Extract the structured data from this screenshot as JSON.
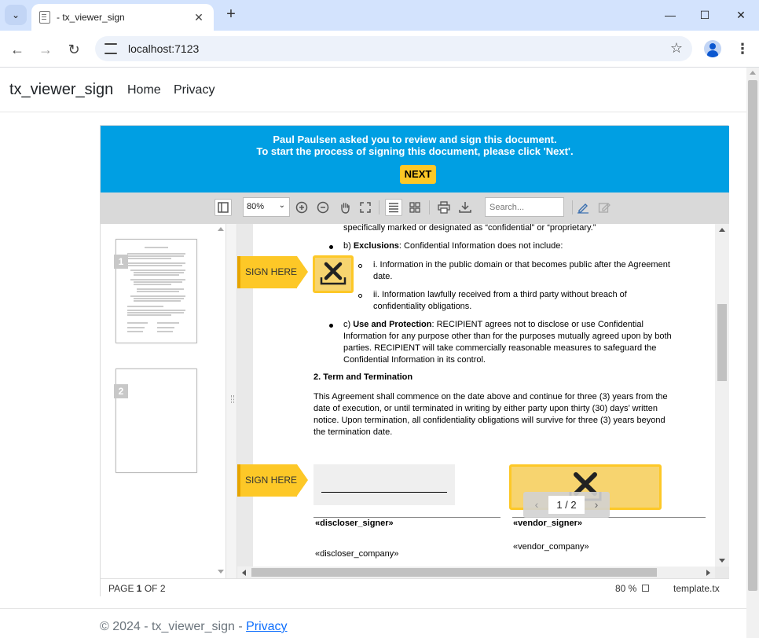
{
  "browser": {
    "tab_title": "- tx_viewer_sign",
    "url": "localhost:7123"
  },
  "site": {
    "brand": "tx_viewer_sign",
    "nav": [
      "Home",
      "Privacy"
    ]
  },
  "banner": {
    "line1": "Paul Paulsen asked you to review and sign this document.",
    "line2": "To start the process of signing this document, please click 'Next'.",
    "next_label": "NEXT",
    "color": "#009fe3",
    "button_color": "#fdc827"
  },
  "viewer_toolbar": {
    "zoom_value": "80%",
    "search_placeholder": "Search..."
  },
  "thumbnails": [
    {
      "number": "1"
    },
    {
      "number": "2"
    }
  ],
  "document": {
    "line_confidential": "specifically marked or designated as “confidential” or “proprietary.”",
    "exclusions_label": "b)",
    "exclusions_bold": "Exclusions",
    "exclusions_text": ": Confidential Information does not include:",
    "excl_i_1": "i. Information in the public domain or that becomes public after the Agreement",
    "excl_i_2": "date.",
    "excl_ii_1": "ii. Information lawfully received from a third party without breach of",
    "excl_ii_2": "confidentiality obligations.",
    "use_label": "c)",
    "use_bold": "Use and Protection",
    "use_text_1": ": RECIPIENT agrees not to disclose or use Confidential",
    "use_text_2": "Information for any purpose other than for the purposes mutually agreed upon by both",
    "use_text_3": "parties. RECIPIENT will take commercially reasonable measures to safeguard the",
    "use_text_4": "Confidential Information in its control.",
    "section2_title": "2. Term and Termination",
    "term_1": "This Agreement shall commence on the date above and continue for three (3) years from the",
    "term_2": "date of execution, or until terminated in writing by either party upon thirty (30) days’ written",
    "term_3": "notice. Upon termination, all confidentiality obligations will survive for three (3) years beyond",
    "term_4": "the termination date.",
    "sign_here_1": "SIGN HERE",
    "sign_here_2": "SIGN HERE",
    "discloser_signer": "«discloser_signer»",
    "discloser_company": "«discloser_company»",
    "vendor_signer": "«vendor_signer»",
    "vendor_company": "«vendor_company»"
  },
  "page_indicator": {
    "current": "1 / 2"
  },
  "statusbar": {
    "page_prefix": "PAGE ",
    "page_current": "1",
    "page_suffix": " OF 2",
    "zoom": "80 %",
    "filename": "template.tx"
  },
  "footer": {
    "text": "© 2024 - tx_viewer_sign - ",
    "link": "Privacy"
  }
}
